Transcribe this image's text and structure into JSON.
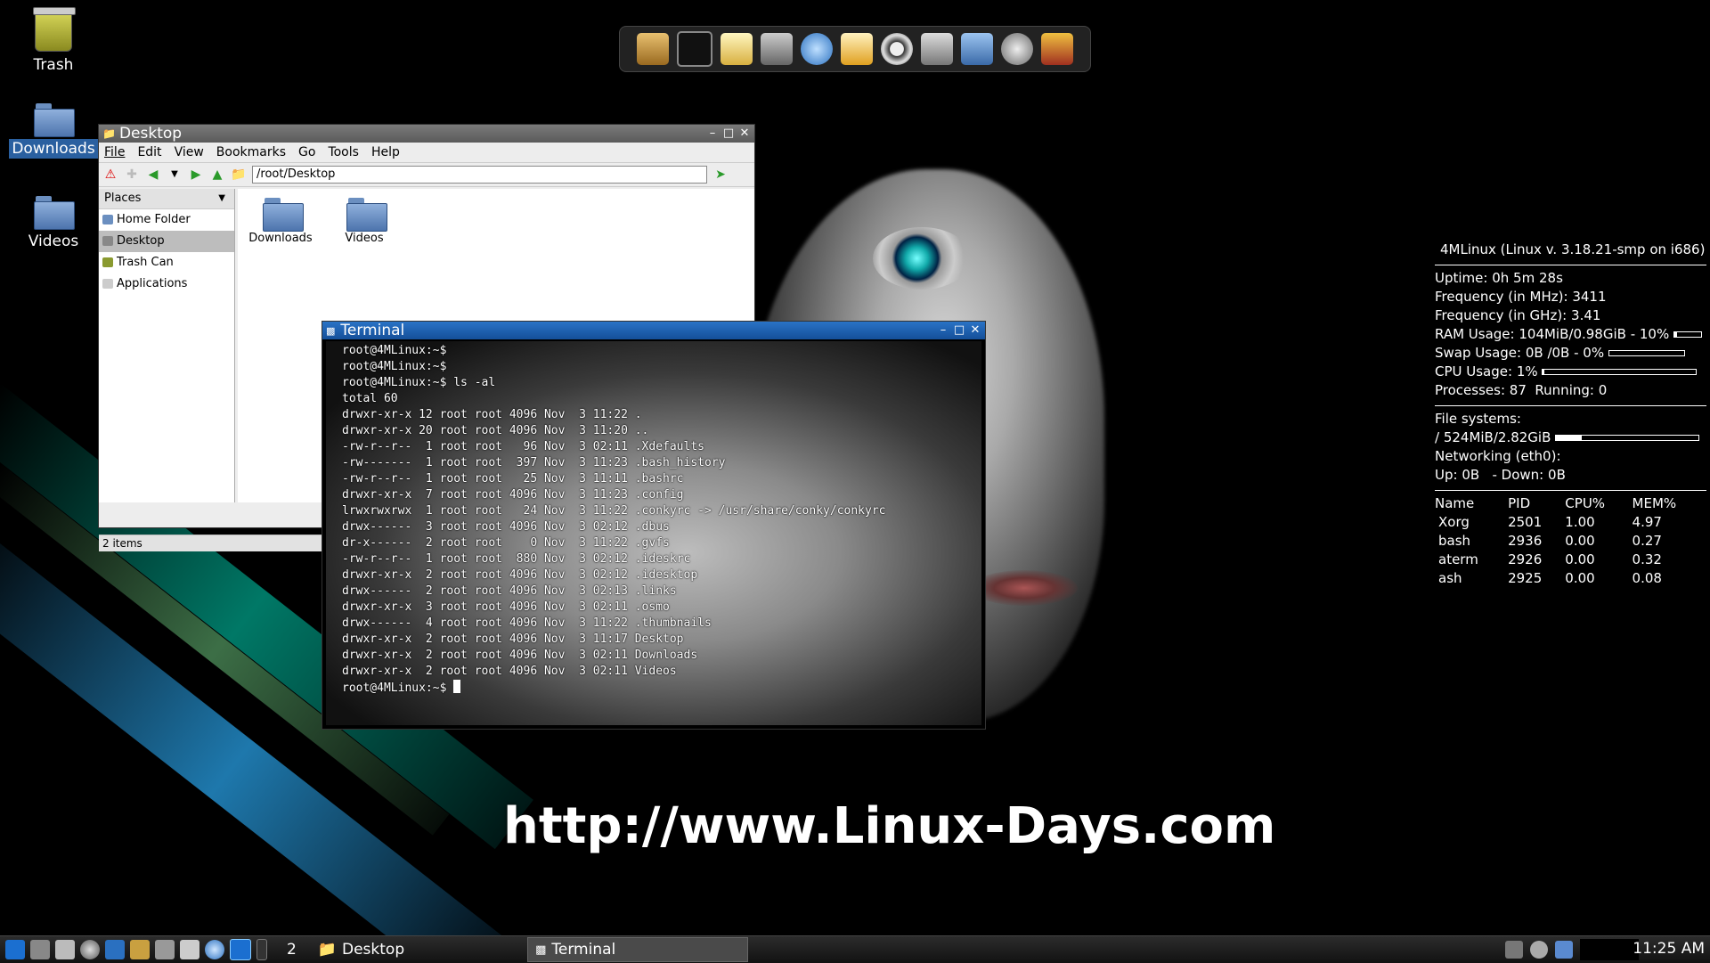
{
  "desktop": {
    "icons": [
      {
        "label": "Trash"
      },
      {
        "label": "Downloads"
      },
      {
        "label": "Videos"
      }
    ],
    "watermark": "http://www.Linux-Days.com"
  },
  "dock": {
    "items": [
      "home-icon",
      "terminal-icon",
      "text-editor-icon",
      "calculator-icon",
      "browser-globe-icon",
      "mail-icon",
      "media-player-icon",
      "camera-icon",
      "file-manager-icon",
      "settings-icon",
      "tools-icon"
    ]
  },
  "file_manager": {
    "title": "Desktop",
    "menu": [
      "File",
      "Edit",
      "View",
      "Bookmarks",
      "Go",
      "Tools",
      "Help"
    ],
    "address": "/root/Desktop",
    "places_header": "Places",
    "places": [
      "Home Folder",
      "Desktop",
      "Trash Can",
      "Applications"
    ],
    "items": [
      "Downloads",
      "Videos"
    ],
    "status": "2 items"
  },
  "terminal": {
    "title": "Terminal",
    "lines": [
      "root@4MLinux:~$",
      "root@4MLinux:~$",
      "root@4MLinux:~$ ls -al",
      "total 60",
      "drwxr-xr-x 12 root root 4096 Nov  3 11:22 .",
      "drwxr-xr-x 20 root root 4096 Nov  3 11:20 ..",
      "-rw-r--r--  1 root root   96 Nov  3 02:11 .Xdefaults",
      "-rw-------  1 root root  397 Nov  3 11:23 .bash_history",
      "-rw-r--r--  1 root root   25 Nov  3 11:11 .bashrc",
      "drwxr-xr-x  7 root root 4096 Nov  3 11:23 .config",
      "lrwxrwxrwx  1 root root   24 Nov  3 11:22 .conkyrc -> /usr/share/conky/conkyrc",
      "drwx------  3 root root 4096 Nov  3 02:12 .dbus",
      "dr-x------  2 root root    0 Nov  3 11:22 .gvfs",
      "-rw-r--r--  1 root root  880 Nov  3 02:12 .ideskrc",
      "drwxr-xr-x  2 root root 4096 Nov  3 02:12 .idesktop",
      "drwx------  2 root root 4096 Nov  3 02:13 .links",
      "drwxr-xr-x  3 root root 4096 Nov  3 02:11 .osmo",
      "drwx------  4 root root 4096 Nov  3 11:22 .thumbnails",
      "drwxr-xr-x  2 root root 4096 Nov  3 11:17 Desktop",
      "drwxr-xr-x  2 root root 4096 Nov  3 02:11 Downloads",
      "drwxr-xr-x  2 root root 4096 Nov  3 02:11 Videos"
    ],
    "prompt": "root@4MLinux:~$ "
  },
  "conky": {
    "header": "4MLinux (Linux v. 3.18.21-smp on i686)",
    "uptime_label": "Uptime:",
    "uptime": "0h 5m 28s",
    "freq_mhz_label": "Frequency (in MHz):",
    "freq_mhz": "3411",
    "freq_ghz_label": "Frequency (in GHz):",
    "freq_ghz": "3.41",
    "ram_label": "RAM Usage:",
    "ram": "104MiB/0.98GiB - 10%",
    "ram_frac": 0.1,
    "swap_label": "Swap Usage:",
    "swap": "0B  /0B   - 0%",
    "swap_frac": 0.0,
    "cpu_label": "CPU Usage:",
    "cpu": "1%",
    "cpu_frac": 0.01,
    "processes_label": "Processes:",
    "processes": "87",
    "running_label": "Running:",
    "running": "0",
    "fs_label": "File systems:",
    "fs_root": "/ 524MiB/2.82GiB",
    "fs_frac": 0.18,
    "net_label": "Networking (eth0):",
    "up_label": "Up:",
    "up": "0B",
    "down_label": "- Down:",
    "down": "0B",
    "proc_headers": [
      "Name",
      "PID",
      "CPU%",
      "MEM%"
    ],
    "procs": [
      [
        "Xorg",
        "2501",
        "1.00",
        "4.97"
      ],
      [
        "bash",
        "2936",
        "0.00",
        "0.27"
      ],
      [
        "aterm",
        "2926",
        "0.00",
        "0.32"
      ],
      [
        "ash",
        "2925",
        "0.00",
        "0.08"
      ]
    ]
  },
  "taskbar": {
    "workspace": "2",
    "tasks": [
      "Desktop",
      "Terminal"
    ],
    "clock": "11:25 AM"
  },
  "colors": {
    "accent": "#2a73c6",
    "selection": "#2a60a0"
  }
}
